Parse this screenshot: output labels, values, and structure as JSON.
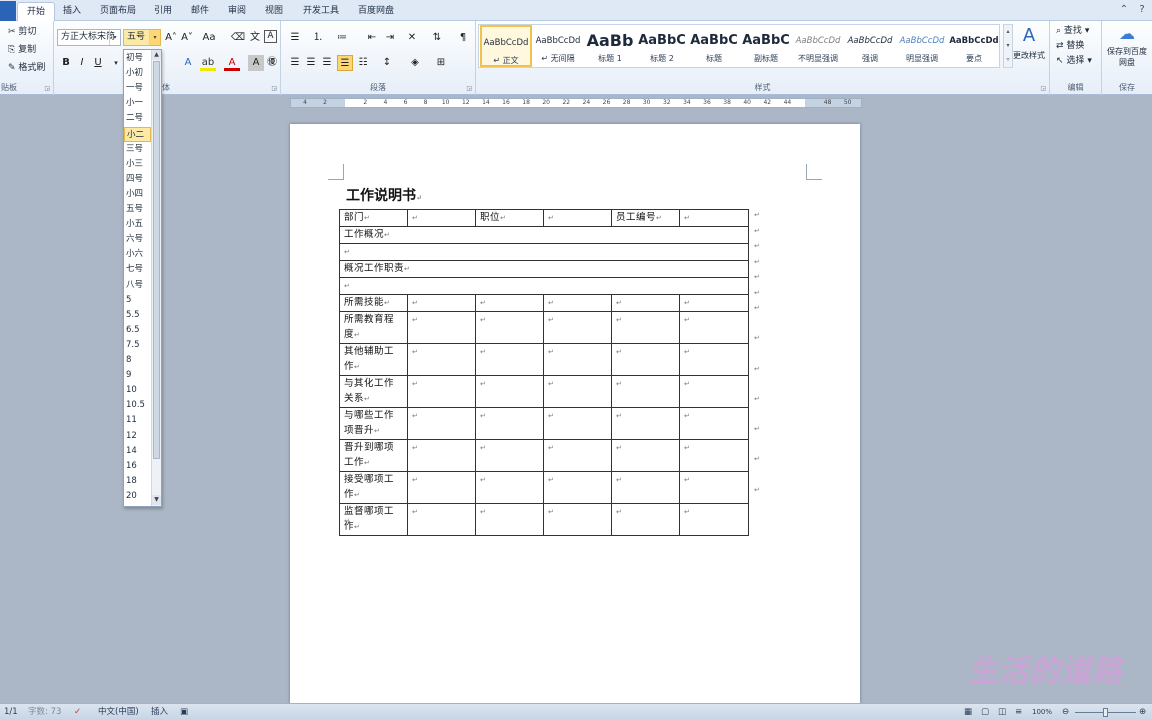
{
  "tabs": {
    "home": "开始",
    "insert": "插入",
    "layout": "页面布局",
    "references": "引用",
    "mailings": "邮件",
    "review": "审阅",
    "view": "视图",
    "developer": "开发工具",
    "baidu": "百度网盘"
  },
  "clipboard": {
    "cut": "剪切",
    "copy": "复制",
    "format_painter": "格式刷",
    "label": "贴板"
  },
  "font": {
    "name": "方正大标宋简",
    "size": "五号",
    "label": "体"
  },
  "paragraph": {
    "label": "段落"
  },
  "styles": {
    "label": "样式",
    "items": [
      {
        "preview": "AaBbCcDd",
        "name": "↵ 正文"
      },
      {
        "preview": "AaBbCcDd",
        "name": "↵ 无间隔"
      },
      {
        "preview": "AaBb",
        "name": "标题 1"
      },
      {
        "preview": "AaBbC",
        "name": "标题 2"
      },
      {
        "preview": "AaBbC",
        "name": "标题"
      },
      {
        "preview": "AaBbC",
        "name": "副标题"
      },
      {
        "preview": "AaBbCcDd",
        "name": "不明显强调"
      },
      {
        "preview": "AaBbCcDd",
        "name": "强调"
      },
      {
        "preview": "AaBbCcDd",
        "name": "明显强调"
      },
      {
        "preview": "AaBbCcDd",
        "name": "要点"
      }
    ],
    "change": "更改样式"
  },
  "editing": {
    "find": "查找",
    "replace": "替换",
    "select": "选择",
    "label": "编辑"
  },
  "save": {
    "button": "保存到百度网盘",
    "label": "保存"
  },
  "ruler": {
    "ticks": [
      "4",
      "2",
      "",
      "2",
      "4",
      "6",
      "8",
      "10",
      "12",
      "14",
      "16",
      "18",
      "20",
      "22",
      "24",
      "26",
      "28",
      "30",
      "32",
      "34",
      "36",
      "38",
      "40",
      "42",
      "44",
      "",
      "48",
      "50"
    ]
  },
  "fontsize_options": [
    "初号",
    "小初",
    "一号",
    "小一",
    "二号",
    "小二",
    "三号",
    "小三",
    "四号",
    "小四",
    "五号",
    "小五",
    "六号",
    "小六",
    "七号",
    "八号",
    "5",
    "5.5",
    "6.5",
    "7.5",
    "8",
    "9",
    "10",
    "10.5",
    "11",
    "12",
    "14",
    "16",
    "18",
    "20"
  ],
  "fontsize_highlighted": "小二",
  "document": {
    "title": "工作说明书",
    "para_mark": "↵",
    "table": {
      "r1": {
        "dept": "部门",
        "position": "职位",
        "staff_no": "员工编号"
      },
      "overview": "工作概况",
      "duties": "概况工作职责",
      "skills": "所需技能",
      "labels": [
        "所需教育程度",
        "其他辅助工作",
        "与其化工作关系",
        "与哪些工作项晋升",
        "晋升到哪项工作",
        "接受哪项工作",
        "监督哪项工作"
      ]
    }
  },
  "status": {
    "page": "1/1",
    "words": "字数: 73",
    "language": "中文(中国)",
    "mode": "插入",
    "zoom": "100%"
  },
  "watermark": "生活的道路"
}
